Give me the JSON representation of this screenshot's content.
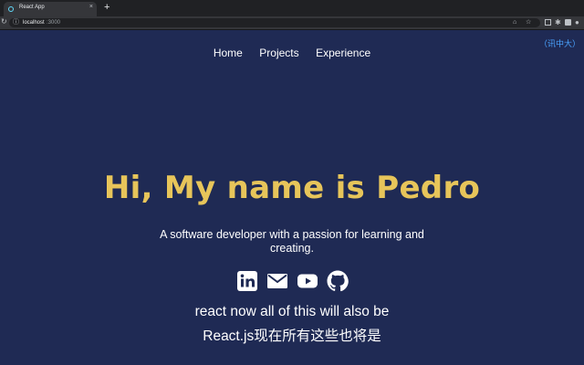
{
  "browser": {
    "tab_title": "React App",
    "tab_close": "×",
    "new_tab": "+",
    "url_host": "localhost",
    "url_port": ":3000"
  },
  "watermark": "（讯中大）",
  "nav": {
    "items": [
      "Home",
      "Projects",
      "Experience"
    ]
  },
  "hero": {
    "title": "Hi, My name is Pedro",
    "tagline": "A software developer with a passion for learning and creating."
  },
  "socials": [
    "linkedin-icon",
    "email-icon",
    "youtube-icon",
    "github-icon"
  ],
  "subtitles": {
    "line1": "react now all of this will also be",
    "line2": "React.js现在所有这些也将是"
  },
  "colors": {
    "background": "#1f2a54",
    "title": "#e7c55a",
    "text": "#ffffff"
  }
}
